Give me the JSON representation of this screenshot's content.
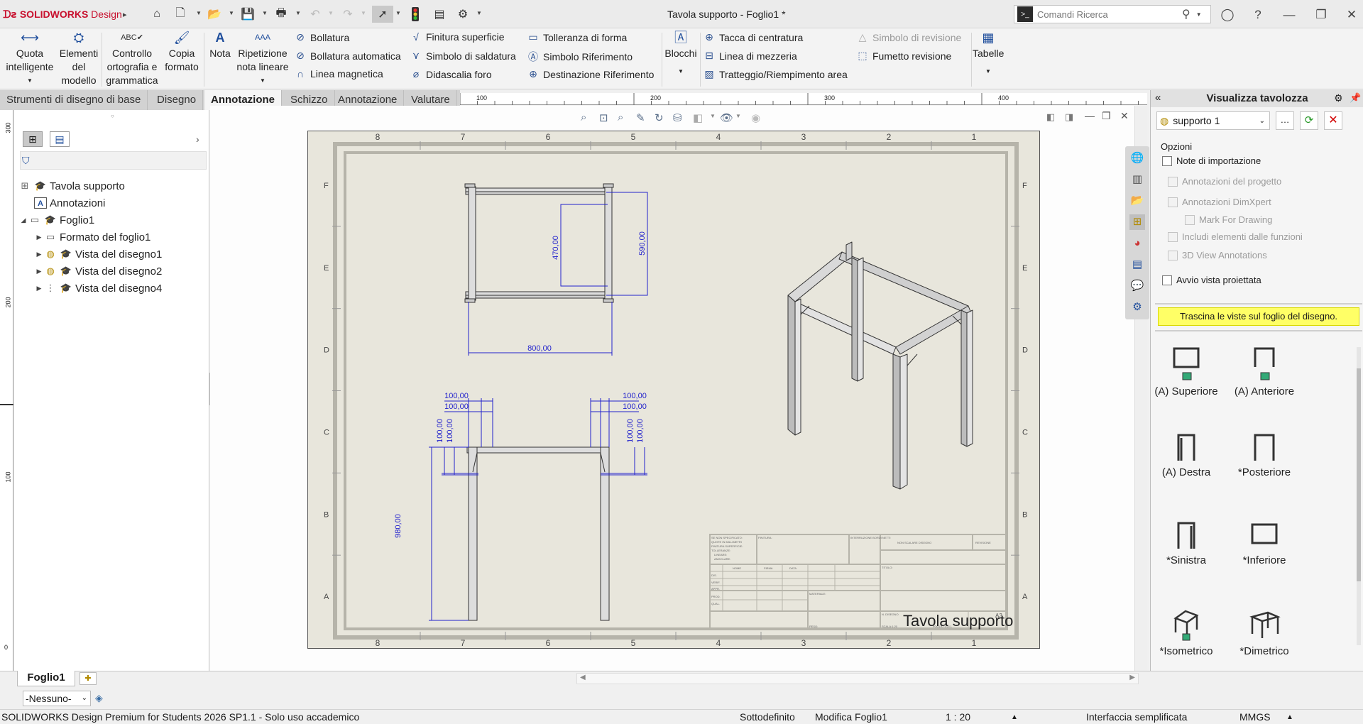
{
  "app": {
    "logo_brand": "SOLIDWORKS",
    "logo_suffix": " Design",
    "document_title": "Tavola supporto - Foglio1 *"
  },
  "search": {
    "placeholder": "Comandi Ricerca"
  },
  "ribbon": {
    "big": [
      {
        "label": "Quota\nintelligente",
        "icon": "smart-dimension-icon"
      },
      {
        "label": "Elementi\ndel\nmodello",
        "icon": "model-items-icon"
      },
      {
        "label": "Controllo\nortografia e\ngrammatica",
        "icon": "spell-check-icon"
      },
      {
        "label": "Copia\nformato",
        "icon": "format-painter-icon"
      },
      {
        "label": "Nota",
        "icon": "note-icon"
      },
      {
        "label": "Ripetizione\nnota lineare",
        "icon": "linear-note-pattern-icon"
      }
    ],
    "col1": [
      "Bollatura",
      "Bollatura automatica",
      "Linea magnetica"
    ],
    "col2": [
      "Finitura superficie",
      "Simbolo di saldatura",
      "Didascalia foro"
    ],
    "col3": [
      "Tolleranza di forma",
      "Simbolo Riferimento",
      "Destinazione Riferimento"
    ],
    "blocchi": "Blocchi",
    "col4": [
      "Tacca di centratura",
      "Linea di mezzeria",
      "Tratteggio/Riempimento area"
    ],
    "col5": [
      "Simbolo di revisione",
      "Fumetto revisione"
    ],
    "tabelle": "Tabelle"
  },
  "tabs": [
    "Strumenti di disegno di base",
    "Disegno",
    "Annotazione",
    "Schizzo",
    "Annotazione",
    "Valutare"
  ],
  "active_tab_index": 2,
  "ruler": {
    "top": [
      "100",
      "200",
      "300",
      "400"
    ],
    "left": [
      "300",
      "200",
      "100",
      "0"
    ]
  },
  "tree": {
    "items": [
      {
        "label": "Tavola supporto",
        "level": 0,
        "icon": "drawing-icon"
      },
      {
        "label": "Annotazioni",
        "level": 1,
        "icon": "annotations-icon"
      },
      {
        "label": "Foglio1",
        "level": 1,
        "icon": "sheet-icon"
      },
      {
        "label": "Formato del foglio1",
        "level": 2,
        "icon": "sheet-format-icon"
      },
      {
        "label": "Vista del disegno1",
        "level": 2,
        "icon": "drawing-view-icon"
      },
      {
        "label": "Vista del disegno2",
        "level": 2,
        "icon": "drawing-view-icon"
      },
      {
        "label": "Vista del disegno4",
        "level": 2,
        "icon": "drawing-view-icon"
      }
    ]
  },
  "sheet": {
    "zone_cols": [
      "8",
      "7",
      "6",
      "5",
      "4",
      "3",
      "2",
      "1"
    ],
    "zone_rows": [
      "F",
      "E",
      "D",
      "C",
      "B",
      "A"
    ],
    "title": "Tavola supporto",
    "size": "A3",
    "dims_top": [
      "470,00",
      "590,00",
      "800,00"
    ],
    "dims_front": [
      "100,00",
      "100,00",
      "100,00",
      "100,00",
      "100,00",
      "100,00",
      "100,00",
      "100,00",
      "980,00"
    ],
    "tb_labels": [
      "SE NON SPECIFICATO:",
      "QUOTE IN MILLIMETRI",
      "FINITURA SUPERFICIE:",
      "TOLLERANZE:",
      "LINEARE:",
      "ANGOLARE:",
      "FINITURA:",
      "INTERRUZIONE BORDI NETTI",
      "NON SCALARE DISEGNO",
      "REVISIONE",
      "NOME",
      "FIRMA",
      "DATA",
      "DIS.",
      "VERIF.",
      "APPR.",
      "PROD.",
      "QUAL.",
      "MATERIALE:",
      "TITOLO:",
      "N. DISEGNO",
      "SCALA:1:20",
      "FOGLIO 1 DI 1",
      "PESO:"
    ]
  },
  "rpanel": {
    "title": "Visualizza tavolozza",
    "model": "supporto 1",
    "opzioni": "Opzioni",
    "options": [
      {
        "label": "Note di importazione",
        "disabled": false
      },
      {
        "label": "Annotazioni del progetto",
        "disabled": true
      },
      {
        "label": "Annotazioni DimXpert",
        "disabled": true
      },
      {
        "label": "Mark For Drawing",
        "disabled": true
      },
      {
        "label": "Includi elementi dalle funzioni",
        "disabled": true
      },
      {
        "label": "3D View Annotations",
        "disabled": true
      },
      {
        "label": "Avvio vista proiettata",
        "disabled": false
      }
    ],
    "hint": "Trascina le viste sul foglio del disegno.",
    "views": [
      "(A) Superiore",
      "(A) Anteriore",
      "(A) Destra",
      "*Posteriore",
      "*Sinistra",
      "*Inferiore",
      "*Isometrico",
      "*Dimetrico"
    ]
  },
  "bottom": {
    "sheet_tab": "Foglio1",
    "layer": "-Nessuno-"
  },
  "status": {
    "app": "SOLIDWORKS Design Premium for Students 2026 SP1.1 - Solo uso accademico",
    "state": "Sottodefinito",
    "mode": "Modifica Foglio1",
    "scale": "1 : 20",
    "ui": "Interfaccia semplificata",
    "units": "MMGS"
  },
  "colors": {
    "accent": "#1f4e9c",
    "dimension": "#2222cc",
    "hint_bg": "#ffff66",
    "close_red": "#d10000"
  }
}
